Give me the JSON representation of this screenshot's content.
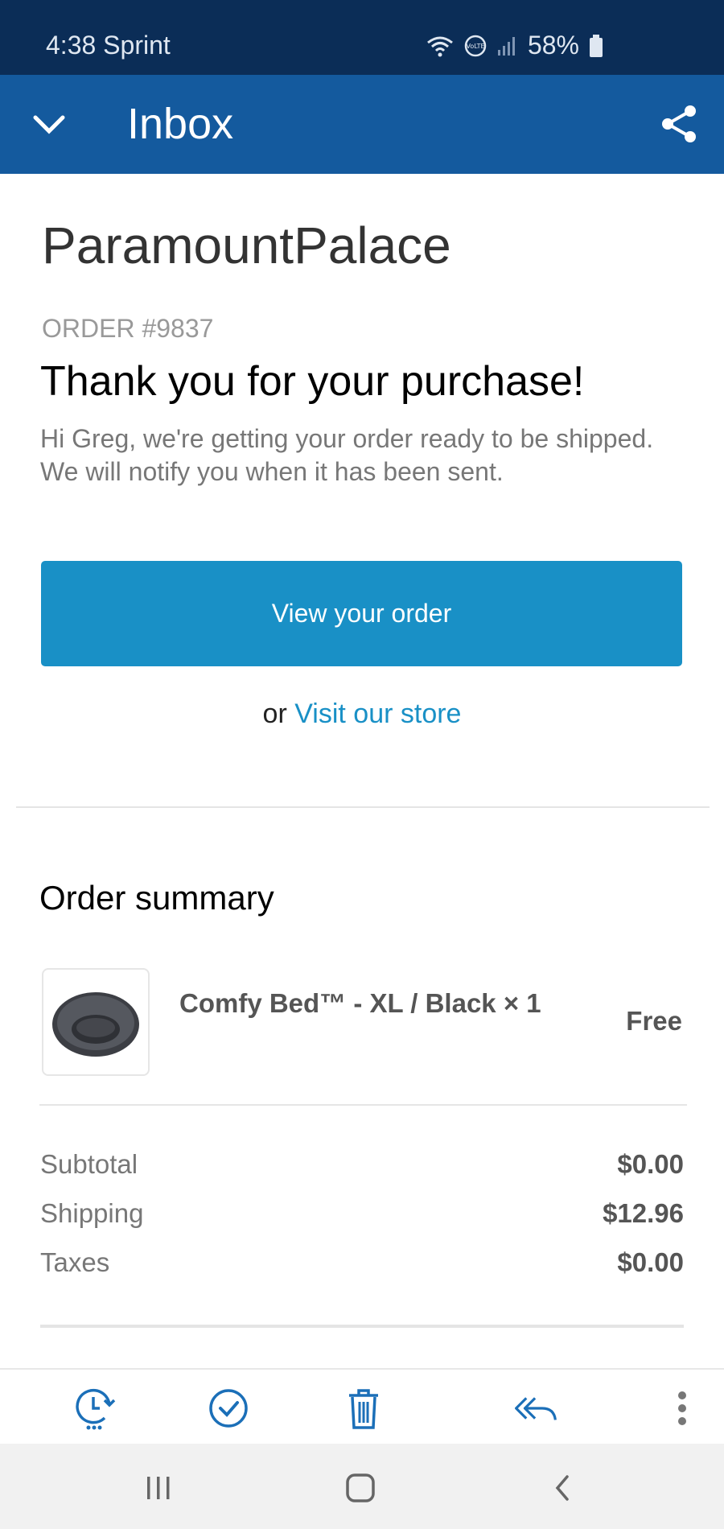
{
  "status_bar": {
    "time": "4:38",
    "carrier": "Sprint",
    "volte": "VoLTE",
    "battery": "58%"
  },
  "app_bar": {
    "title": "Inbox"
  },
  "email": {
    "shop_name": "ParamountPalace",
    "order_number": "ORDER #9837",
    "headline": "Thank you for your purchase!",
    "intro": "Hi Greg, we're getting your order ready to be shipped. We will notify you when it has been sent.",
    "view_order_label": "View your order",
    "store_prefix": "or",
    "store_link_label": "Visit our store",
    "summary_title": "Order summary",
    "line_items": [
      {
        "name": "Comfy Bed™ - XL / Black × 1",
        "price": "Free"
      }
    ],
    "totals": [
      {
        "label": "Subtotal",
        "value": "$0.00"
      },
      {
        "label": "Shipping",
        "value": "$12.96"
      },
      {
        "label": "Taxes",
        "value": "$0.00"
      }
    ]
  },
  "icons": {
    "back": "chevron-down-icon",
    "share": "share-icon",
    "actions": [
      "snooze-icon",
      "check-icon",
      "trash-icon",
      "reply-all-icon",
      "more-vertical-icon"
    ],
    "nav": [
      "recent-apps-icon",
      "home-icon",
      "back-icon"
    ]
  },
  "colors": {
    "status_bar": "#0b2d57",
    "app_bar": "#145a9e",
    "button": "#1990c6",
    "link": "#1990c6",
    "action_icons": "#1b6fb8"
  }
}
